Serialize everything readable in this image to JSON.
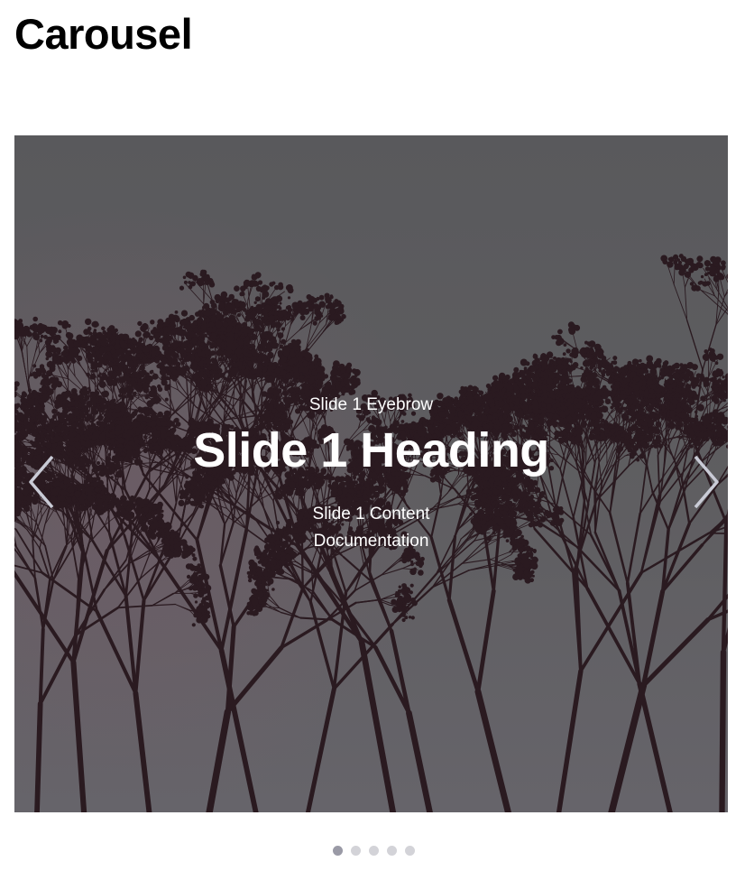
{
  "page": {
    "title": "Carousel"
  },
  "carousel": {
    "slides": [
      {
        "eyebrow": "Slide 1 Eyebrow",
        "heading": "Slide 1 Heading",
        "content": "Slide 1 Content Documentation"
      }
    ],
    "active_index": 0,
    "indicator_count": 5,
    "prev_icon": "chevron-left-icon",
    "next_icon": "chevron-right-icon",
    "colors": {
      "indicator_active": "#9a9aa6",
      "indicator_inactive": "#d3d3d8",
      "text": "#ffffff"
    }
  }
}
